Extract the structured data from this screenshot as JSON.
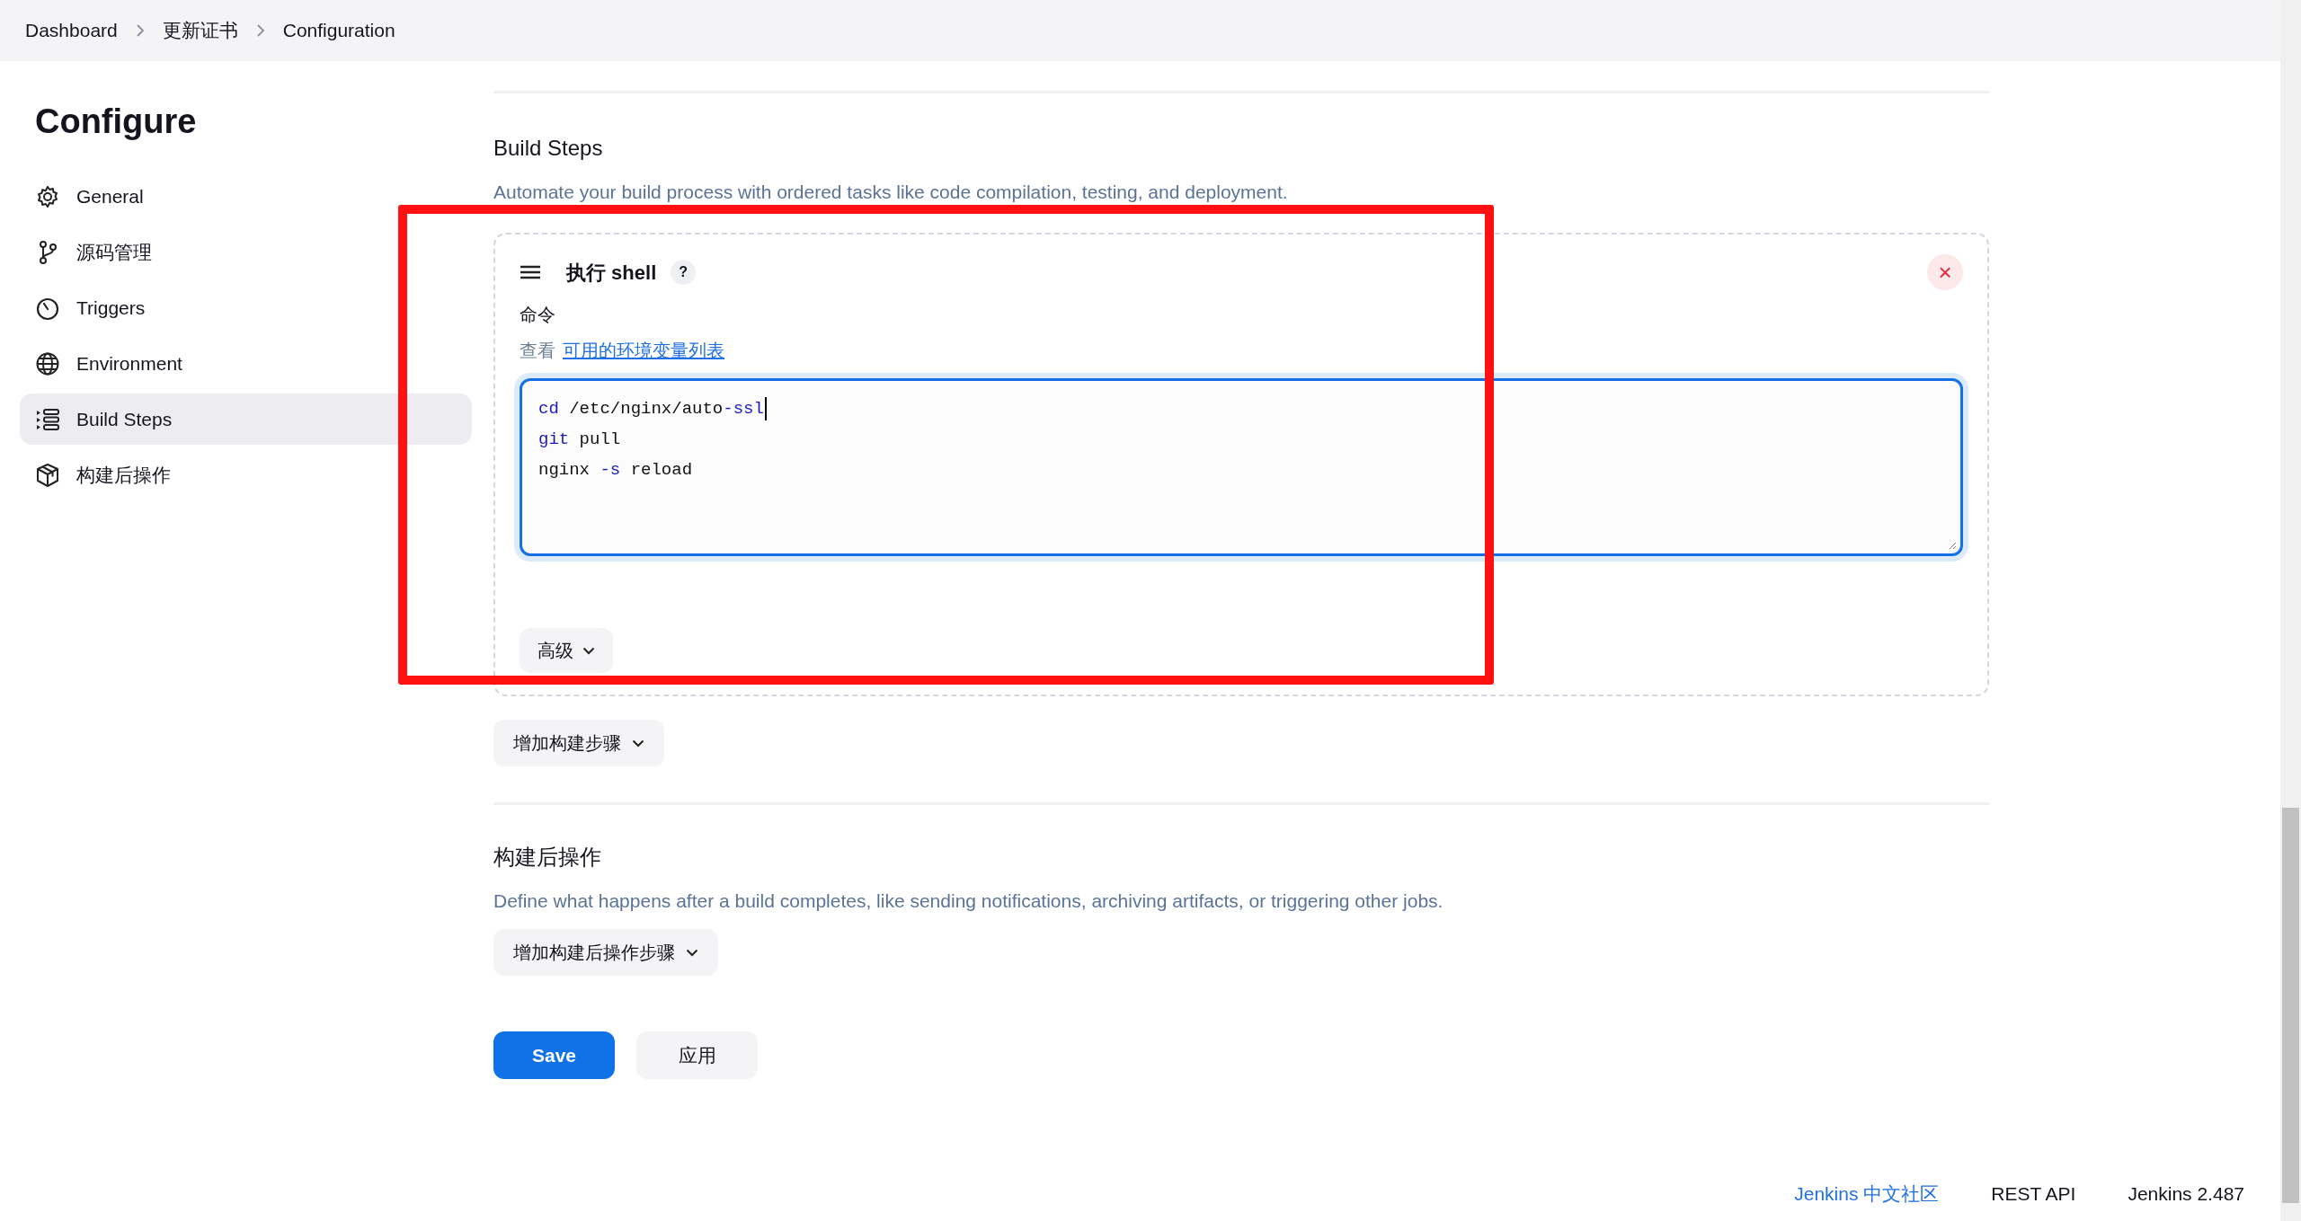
{
  "breadcrumb": [
    {
      "label": "Dashboard"
    },
    {
      "label": "更新证书"
    },
    {
      "label": "Configuration"
    }
  ],
  "sidebar": {
    "title": "Configure",
    "items": [
      {
        "label": "General",
        "selected": false
      },
      {
        "label": "源码管理",
        "selected": false
      },
      {
        "label": "Triggers",
        "selected": false
      },
      {
        "label": "Environment",
        "selected": false
      },
      {
        "label": "Build Steps",
        "selected": true
      },
      {
        "label": "构建后操作",
        "selected": false
      }
    ]
  },
  "build_steps": {
    "title": "Build Steps",
    "description": "Automate your build process with ordered tasks like code compilation, testing, and deployment.",
    "step": {
      "title": "执行 shell",
      "help": "?",
      "close": "×",
      "command_label": "命令",
      "env_prefix": "查看",
      "env_link": "可用的环境变量列表",
      "focused": true,
      "lines": [
        [
          {
            "text": "cd",
            "kind": "keyword"
          },
          {
            "text": " /etc/nginx/auto",
            "kind": "plain"
          },
          {
            "text": "-ssl",
            "kind": "keyword"
          }
        ],
        [
          {
            "text": "git",
            "kind": "keyword"
          },
          {
            "text": " pull",
            "kind": "plain"
          }
        ],
        [
          {
            "text": "nginx ",
            "kind": "plain"
          },
          {
            "text": "-s",
            "kind": "keyword"
          },
          {
            "text": " reload",
            "kind": "plain"
          }
        ]
      ],
      "advanced": "高级"
    },
    "add_button": "增加构建步骤"
  },
  "post_build": {
    "title": "构建后操作",
    "description": "Define what happens after a build completes, like sending notifications, archiving artifacts, or triggering other jobs.",
    "add_button": "增加构建后操作步骤"
  },
  "actions": [
    {
      "label": "Save",
      "kind": "primary"
    },
    {
      "label": "应用",
      "kind": "secondary"
    }
  ],
  "footer": [
    {
      "label": "Jenkins 中文社区",
      "kind": "link"
    },
    {
      "label": "REST API",
      "kind": "plain"
    },
    {
      "label": "Jenkins 2.487",
      "kind": "plain"
    }
  ]
}
